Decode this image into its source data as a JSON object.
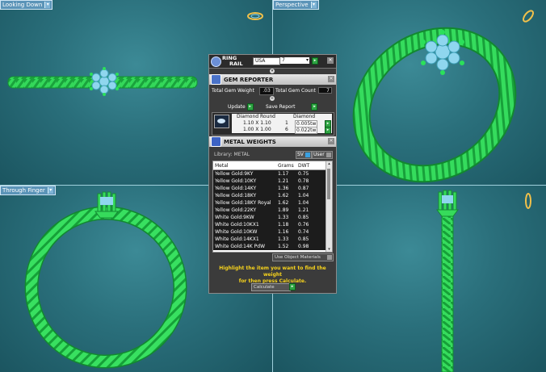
{
  "viewports": {
    "top_left": {
      "label": "Looking Down"
    },
    "top_right": {
      "label": "Perspective"
    },
    "bottom_left": {
      "label": "Through Finger"
    }
  },
  "panel": {
    "ring_rail": {
      "title_line1": "RING",
      "title_line2": "RAIL",
      "size_system": "USA",
      "size_value": "7"
    },
    "gem_reporter": {
      "title": "GEM REPORTER",
      "total_gem_weight_label": "Total Gem Weight",
      "total_gem_weight_value": ".03",
      "total_gem_count_label": "Total Gem Count",
      "total_gem_count_value": "7",
      "update_label": "Update",
      "save_report_label": "Save Report",
      "columns": [
        "Diamond Round",
        "Diamond"
      ],
      "rows": [
        {
          "size": "1.10 X 1.10",
          "count": "1",
          "weight": "0.005tw"
        },
        {
          "size": "1.00 X 1.00",
          "count": "6",
          "weight": "0.022tw"
        }
      ]
    },
    "metal_weights": {
      "title": "METAL WEIGHTS",
      "library_label": "Library: METAL",
      "toggle_sv": "SV",
      "toggle_user": "User",
      "columns": [
        "Metal",
        "Grams",
        "DWT"
      ],
      "rows": [
        {
          "metal": "Yellow Gold:9KY",
          "grams": "1.17",
          "dwt": "0.75"
        },
        {
          "metal": "Yellow Gold:10KY",
          "grams": "1.21",
          "dwt": "0.78"
        },
        {
          "metal": "Yellow Gold:14KY",
          "grams": "1.36",
          "dwt": "0.87"
        },
        {
          "metal": "Yellow Gold:18KY",
          "grams": "1.62",
          "dwt": "1.04"
        },
        {
          "metal": "Yellow Gold:18KY Royal",
          "grams": "1.62",
          "dwt": "1.04"
        },
        {
          "metal": "Yellow Gold:22KY",
          "grams": "1.89",
          "dwt": "1.21"
        },
        {
          "metal": "White Gold:9KW",
          "grams": "1.33",
          "dwt": "0.85"
        },
        {
          "metal": "White Gold:10KX1",
          "grams": "1.18",
          "dwt": "0.76"
        },
        {
          "metal": "White Gold:10KW",
          "grams": "1.16",
          "dwt": "0.74"
        },
        {
          "metal": "White Gold:14KX1",
          "grams": "1.33",
          "dwt": "0.85"
        },
        {
          "metal": "White Gold:14K PdW",
          "grams": "1.52",
          "dwt": "0.98"
        }
      ],
      "use_object_materials_label": "Use Object Materials",
      "hint_line1": "Highlight the item you want to find the weight",
      "hint_line2": "for then press Calculate.",
      "calculate_label": "Calculate"
    }
  },
  "colors": {
    "ring": "#3ef064",
    "ring_dark": "#17a43a",
    "gem": "#8fd6ee",
    "viewport_bg": "#2b6f7a",
    "panel_bg": "#3b3b3b",
    "hint_text": "#f6d21c"
  }
}
